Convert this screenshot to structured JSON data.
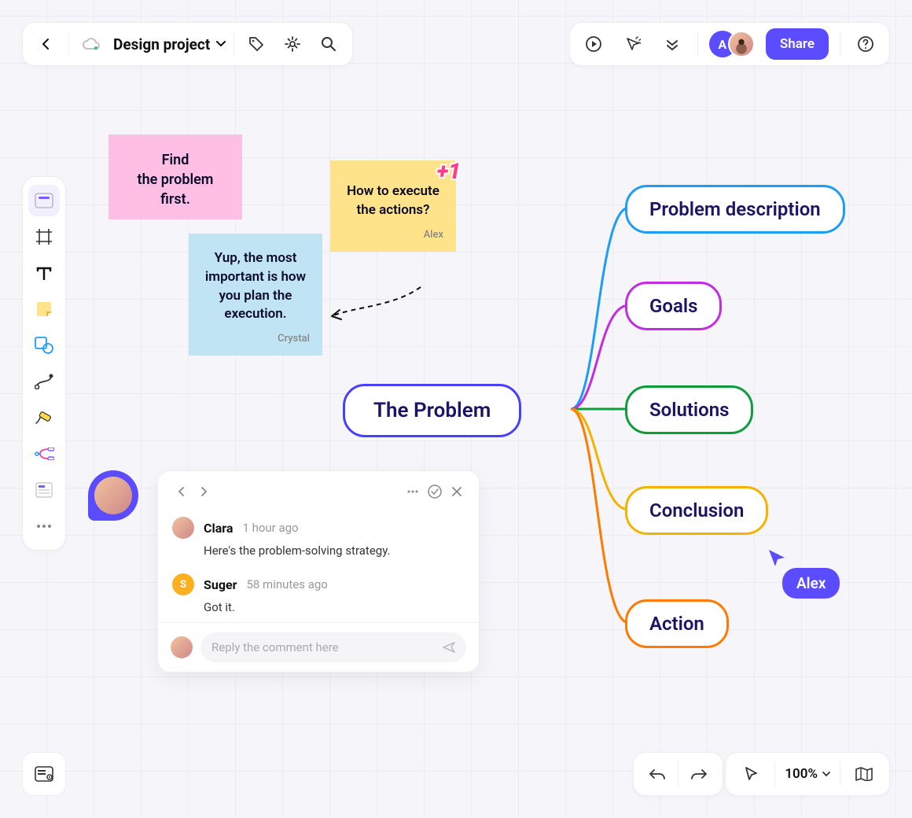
{
  "header": {
    "title": "Design project",
    "share_label": "Share",
    "avatar_initial": "A"
  },
  "notes": {
    "pink": {
      "text": "Find\nthe problem first."
    },
    "blue": {
      "text": "Yup, the most important is how you plan the execution.",
      "author": "Crystal"
    },
    "yellow": {
      "text": "How to execute the actions?",
      "author": "Alex",
      "badge": "+1"
    }
  },
  "mindmap": {
    "root": "The Problem",
    "children": [
      {
        "label": "Problem description",
        "color": "#1e9df7"
      },
      {
        "label": "Goals",
        "color": "#c12de0"
      },
      {
        "label": "Solutions",
        "color": "#0f9d3c"
      },
      {
        "label": "Conclusion",
        "color": "#f5b301"
      },
      {
        "label": "Action",
        "color": "#ff7a00"
      }
    ]
  },
  "comments": {
    "items": [
      {
        "name": "Clara",
        "time": "1 hour ago",
        "body": "Here's the problem-solving strategy.",
        "avatar": "photo"
      },
      {
        "name": "Suger",
        "time": "58 minutes ago",
        "body": "Got it.",
        "avatar": "S",
        "avatar_bg": "#ffb020"
      }
    ],
    "reply_placeholder": "Reply the comment here"
  },
  "cursor": {
    "label": "Alex"
  },
  "zoom": {
    "value": "100%"
  }
}
